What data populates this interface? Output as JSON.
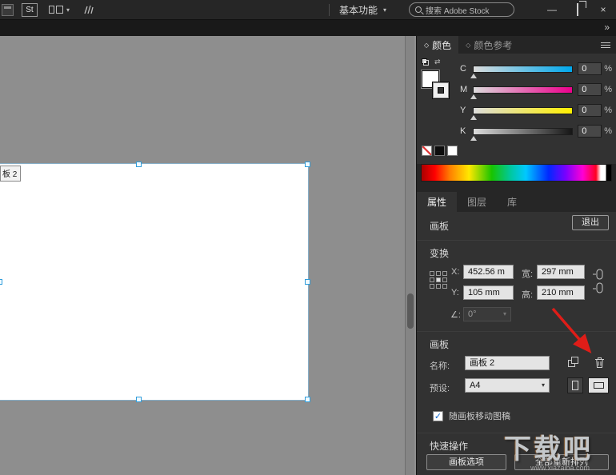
{
  "titlebar": {
    "st_badge": "St",
    "workspace_label": "基本功能",
    "search_placeholder": "搜索 Adobe Stock"
  },
  "icons": {
    "chevron_down": "▾",
    "overflow": "»",
    "minimize": "—",
    "close": "×",
    "collapse_diamond": "◇",
    "swap": "⇄",
    "check": "✓"
  },
  "color_panel": {
    "tab_color": "颜色",
    "tab_color_guide": "颜色参考",
    "sliders": [
      {
        "channel": "C",
        "value": "0",
        "unit": "%"
      },
      {
        "channel": "M",
        "value": "0",
        "unit": "%"
      },
      {
        "channel": "Y",
        "value": "0",
        "unit": "%"
      },
      {
        "channel": "K",
        "value": "0",
        "unit": "%"
      }
    ]
  },
  "properties_panel": {
    "tab_properties": "属性",
    "tab_layers": "图层",
    "tab_libraries": "库",
    "artboard_header": "画板",
    "exit_button": "退出",
    "transform": {
      "section_title": "变换",
      "x_label": "X:",
      "x_value": "452.56 m",
      "width_label": "宽:",
      "width_value": "297 mm",
      "y_label": "Y:",
      "y_value": "105 mm",
      "height_label": "高:",
      "height_value": "210 mm",
      "angle_label": "∠:",
      "angle_value": "0°"
    },
    "artboard_section": {
      "section_title": "画板",
      "name_label": "名称:",
      "name_value": "画板 2",
      "preset_label": "预设:",
      "preset_value": "A4",
      "move_with_artboard_label": "随画板移动图稿"
    },
    "quick_actions": {
      "section_title": "快速操作",
      "artboard_options_button": "画板选项",
      "rearrange_all_button": "全部重新排列"
    }
  },
  "canvas": {
    "artboard_label": "板 2"
  },
  "watermark": {
    "text": "下载吧",
    "subtext": "www.xiazaiba.com"
  },
  "colors": {
    "accent_blue": "#1473e6",
    "annotation_red": "#df1d18",
    "cyan": "#00a8ec",
    "magenta": "#ec008c",
    "yellow": "#fff000"
  }
}
